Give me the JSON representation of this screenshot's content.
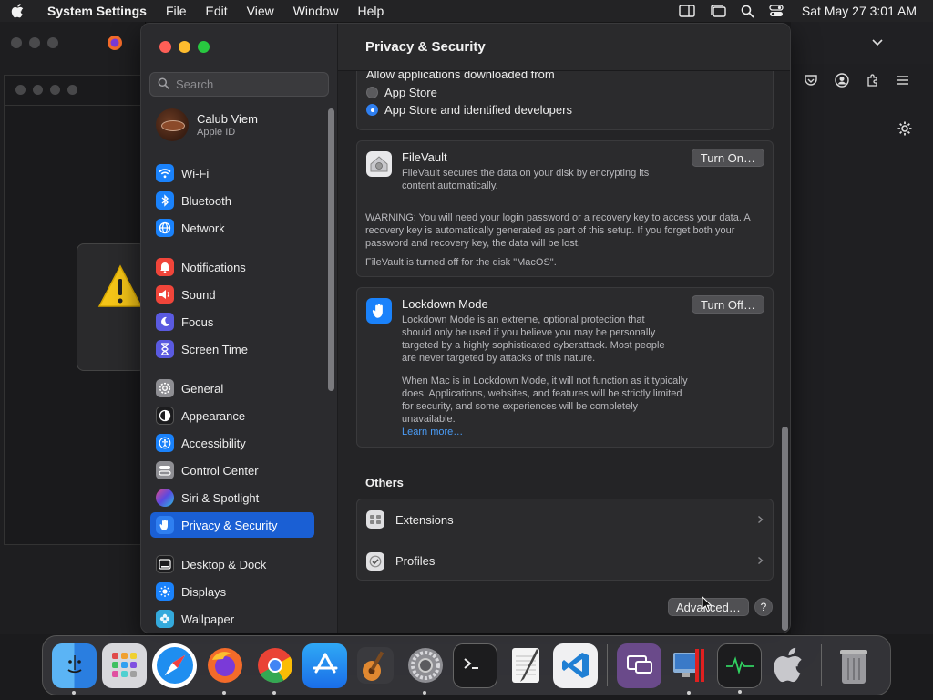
{
  "menubar": {
    "app_name": "System Settings",
    "menus": [
      "File",
      "Edit",
      "View",
      "Window",
      "Help"
    ],
    "clock": "Sat May 27  3:01 AM"
  },
  "window": {
    "title": "Privacy & Security",
    "search": {
      "placeholder": "Search"
    },
    "user": {
      "name": "Calub Viem",
      "subtitle": "Apple ID"
    },
    "sidebar_items": [
      {
        "label": "Wi-Fi",
        "icon": "wifi-icon",
        "color": "#1a82fb"
      },
      {
        "label": "Bluetooth",
        "icon": "bluetooth-icon",
        "color": "#1a82fb"
      },
      {
        "label": "Network",
        "icon": "globe-icon",
        "color": "#1a82fb"
      },
      {
        "label": "Notifications",
        "icon": "bell-icon",
        "color": "#f0453a"
      },
      {
        "label": "Sound",
        "icon": "speaker-icon",
        "color": "#f0453a"
      },
      {
        "label": "Focus",
        "icon": "moon-icon",
        "color": "#5a5ae0"
      },
      {
        "label": "Screen Time",
        "icon": "hourglass-icon",
        "color": "#5a5ae0"
      },
      {
        "label": "General",
        "icon": "gear-icon",
        "color": "#8e8e93"
      },
      {
        "label": "Appearance",
        "icon": "appearance-icon",
        "color": "#1c1c1e"
      },
      {
        "label": "Accessibility",
        "icon": "accessibility-icon",
        "color": "#1a82fb"
      },
      {
        "label": "Control Center",
        "icon": "toggles-icon",
        "color": "#8e8e93"
      },
      {
        "label": "Siri & Spotlight",
        "icon": "siri-icon",
        "color": "#b04ad8"
      },
      {
        "label": "Privacy & Security",
        "icon": "hand-icon",
        "color": "#1a82fb"
      },
      {
        "label": "Desktop & Dock",
        "icon": "dock-icon",
        "color": "#1c1c1e"
      },
      {
        "label": "Displays",
        "icon": "sun-icon",
        "color": "#1a82fb"
      },
      {
        "label": "Wallpaper",
        "icon": "flower-icon",
        "color": "#34aadc"
      }
    ],
    "allow": {
      "label": "Allow applications downloaded from",
      "options": [
        "App Store",
        "App Store and identified developers"
      ],
      "selected": "App Store and identified developers"
    },
    "filevault": {
      "title": "FileVault",
      "description": "FileVault secures the data on your disk by encrypting its content automatically.",
      "warning": "WARNING: You will need your login password or a recovery key to access your data. A recovery key is automatically generated as part of this setup. If you forget both your password and recovery key, the data will be lost.",
      "status": "FileVault is turned off for the disk \"MacOS\".",
      "button": "Turn On…"
    },
    "lockdown": {
      "title": "Lockdown Mode",
      "description": "Lockdown Mode is an extreme, optional protection that should only be used if you believe you may be personally targeted by a highly sophisticated cyberattack. Most people are never targeted by attacks of this nature.",
      "description2": "When Mac is in Lockdown Mode, it will not function as it typically does. Applications, websites, and features will be strictly limited for security, and some experiences will be completely unavailable.",
      "learn_more": "Learn more…",
      "button": "Turn Off…"
    },
    "others": {
      "heading": "Others",
      "items": [
        "Extensions",
        "Profiles"
      ]
    },
    "advanced_button": "Advanced…",
    "help_button": "?"
  },
  "dock": [
    {
      "name": "Finder",
      "color": "#3b8fe8"
    },
    {
      "name": "Launchpad",
      "color": "#d8d8dc"
    },
    {
      "name": "Safari",
      "color": "#1f8ef0"
    },
    {
      "name": "Firefox",
      "color": "#f36b2a"
    },
    {
      "name": "Chrome",
      "color": "#ffffff"
    },
    {
      "name": "App Store",
      "color": "#1f8ef0"
    },
    {
      "name": "GarageBand",
      "color": "#4a4a4e"
    },
    {
      "name": "System Settings",
      "color": "#8e8e93"
    },
    {
      "name": "Terminal",
      "color": "#1c1c1e"
    },
    {
      "name": "TextEdit",
      "color": "#f0f0f0"
    },
    {
      "name": "Visual Studio Code",
      "color": "#1f7fd4"
    },
    {
      "name": "Remote Desktop",
      "color": "#6a4a8a"
    },
    {
      "name": "Parallels",
      "color": "#3a3a3e"
    },
    {
      "name": "Activity Monitor",
      "color": "#1c1c1e"
    },
    {
      "name": "Boot Camp",
      "color": "#c8c8cc"
    },
    {
      "name": "Trash",
      "color": "#8e8e93"
    }
  ]
}
